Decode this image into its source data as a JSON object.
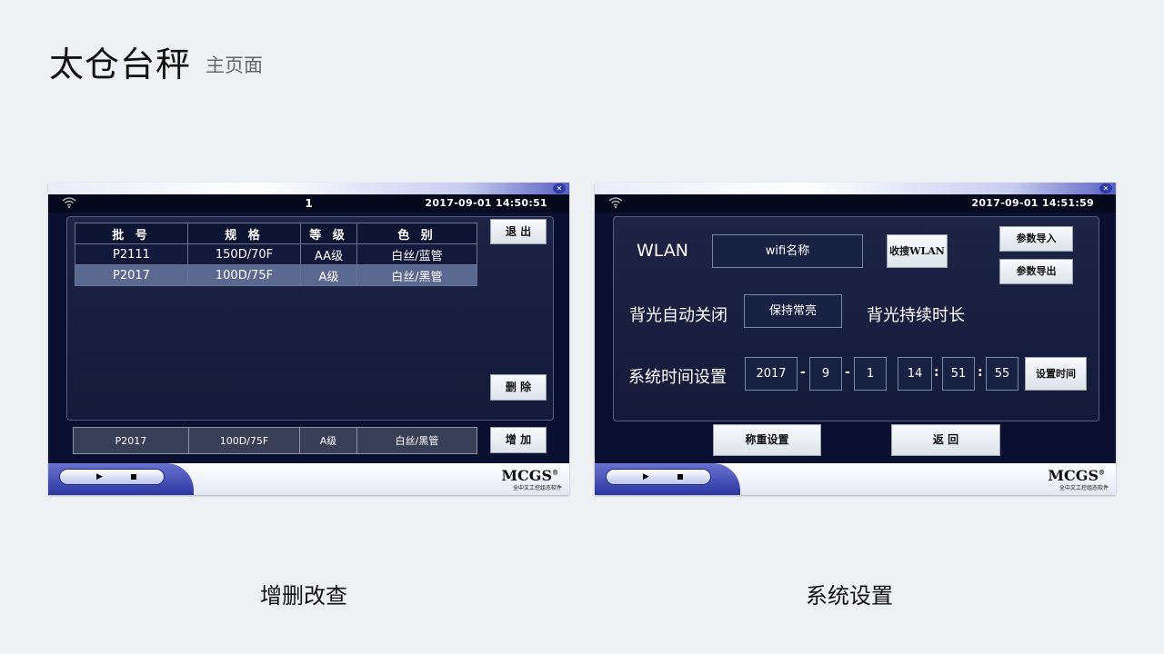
{
  "header": {
    "title": "太仓台秤",
    "subtitle": "主页面"
  },
  "captions": {
    "left": "增删改查",
    "right": "系统设置"
  },
  "screen1": {
    "status_center": "1",
    "status_time": "2017-09-01 14:50:51",
    "table": {
      "headers": [
        "批 号",
        "规 格",
        "等 级",
        "色 别"
      ],
      "rows": [
        [
          "P2111",
          "150D/70F",
          "AA级",
          "白丝/蓝管"
        ],
        [
          "P2017",
          "100D/75F",
          "A级",
          "白丝/黑管"
        ]
      ],
      "selected_row": 1
    },
    "buttons": {
      "exit": "退 出",
      "delete": "删 除",
      "add": "增 加"
    },
    "entry": {
      "batch": "P2017",
      "spec": "100D/75F",
      "grade": "A级",
      "color": "白丝/黑管"
    }
  },
  "screen2": {
    "status_time": "2017-09-01 14:51:59",
    "wlan_label": "WLAN",
    "wifi_name": "wifi名称",
    "search_wlan": "收搜WLAN",
    "import_params": "参数导入",
    "export_params": "参数导出",
    "backlight_label": "背光自动关闭",
    "backlight_value": "保持常亮",
    "backlight_duration_label": "背光持续时长",
    "time_label": "系统时间设置",
    "time": {
      "year": "2017",
      "month": "9",
      "day": "1",
      "hour": "14",
      "minute": "51",
      "second": "55"
    },
    "date_sep": "-",
    "time_sep": ":",
    "set_time": "设置时间",
    "scale_settings": "称重设置",
    "back": "返 回"
  },
  "footer": {
    "logo": "MCGS",
    "logo_mark": "®",
    "logo_sub": "全中文工控组态软件"
  },
  "icons": {
    "wifi": "wifi-icon",
    "close": "close-icon",
    "play": "play-icon",
    "stop": "stop-icon"
  }
}
